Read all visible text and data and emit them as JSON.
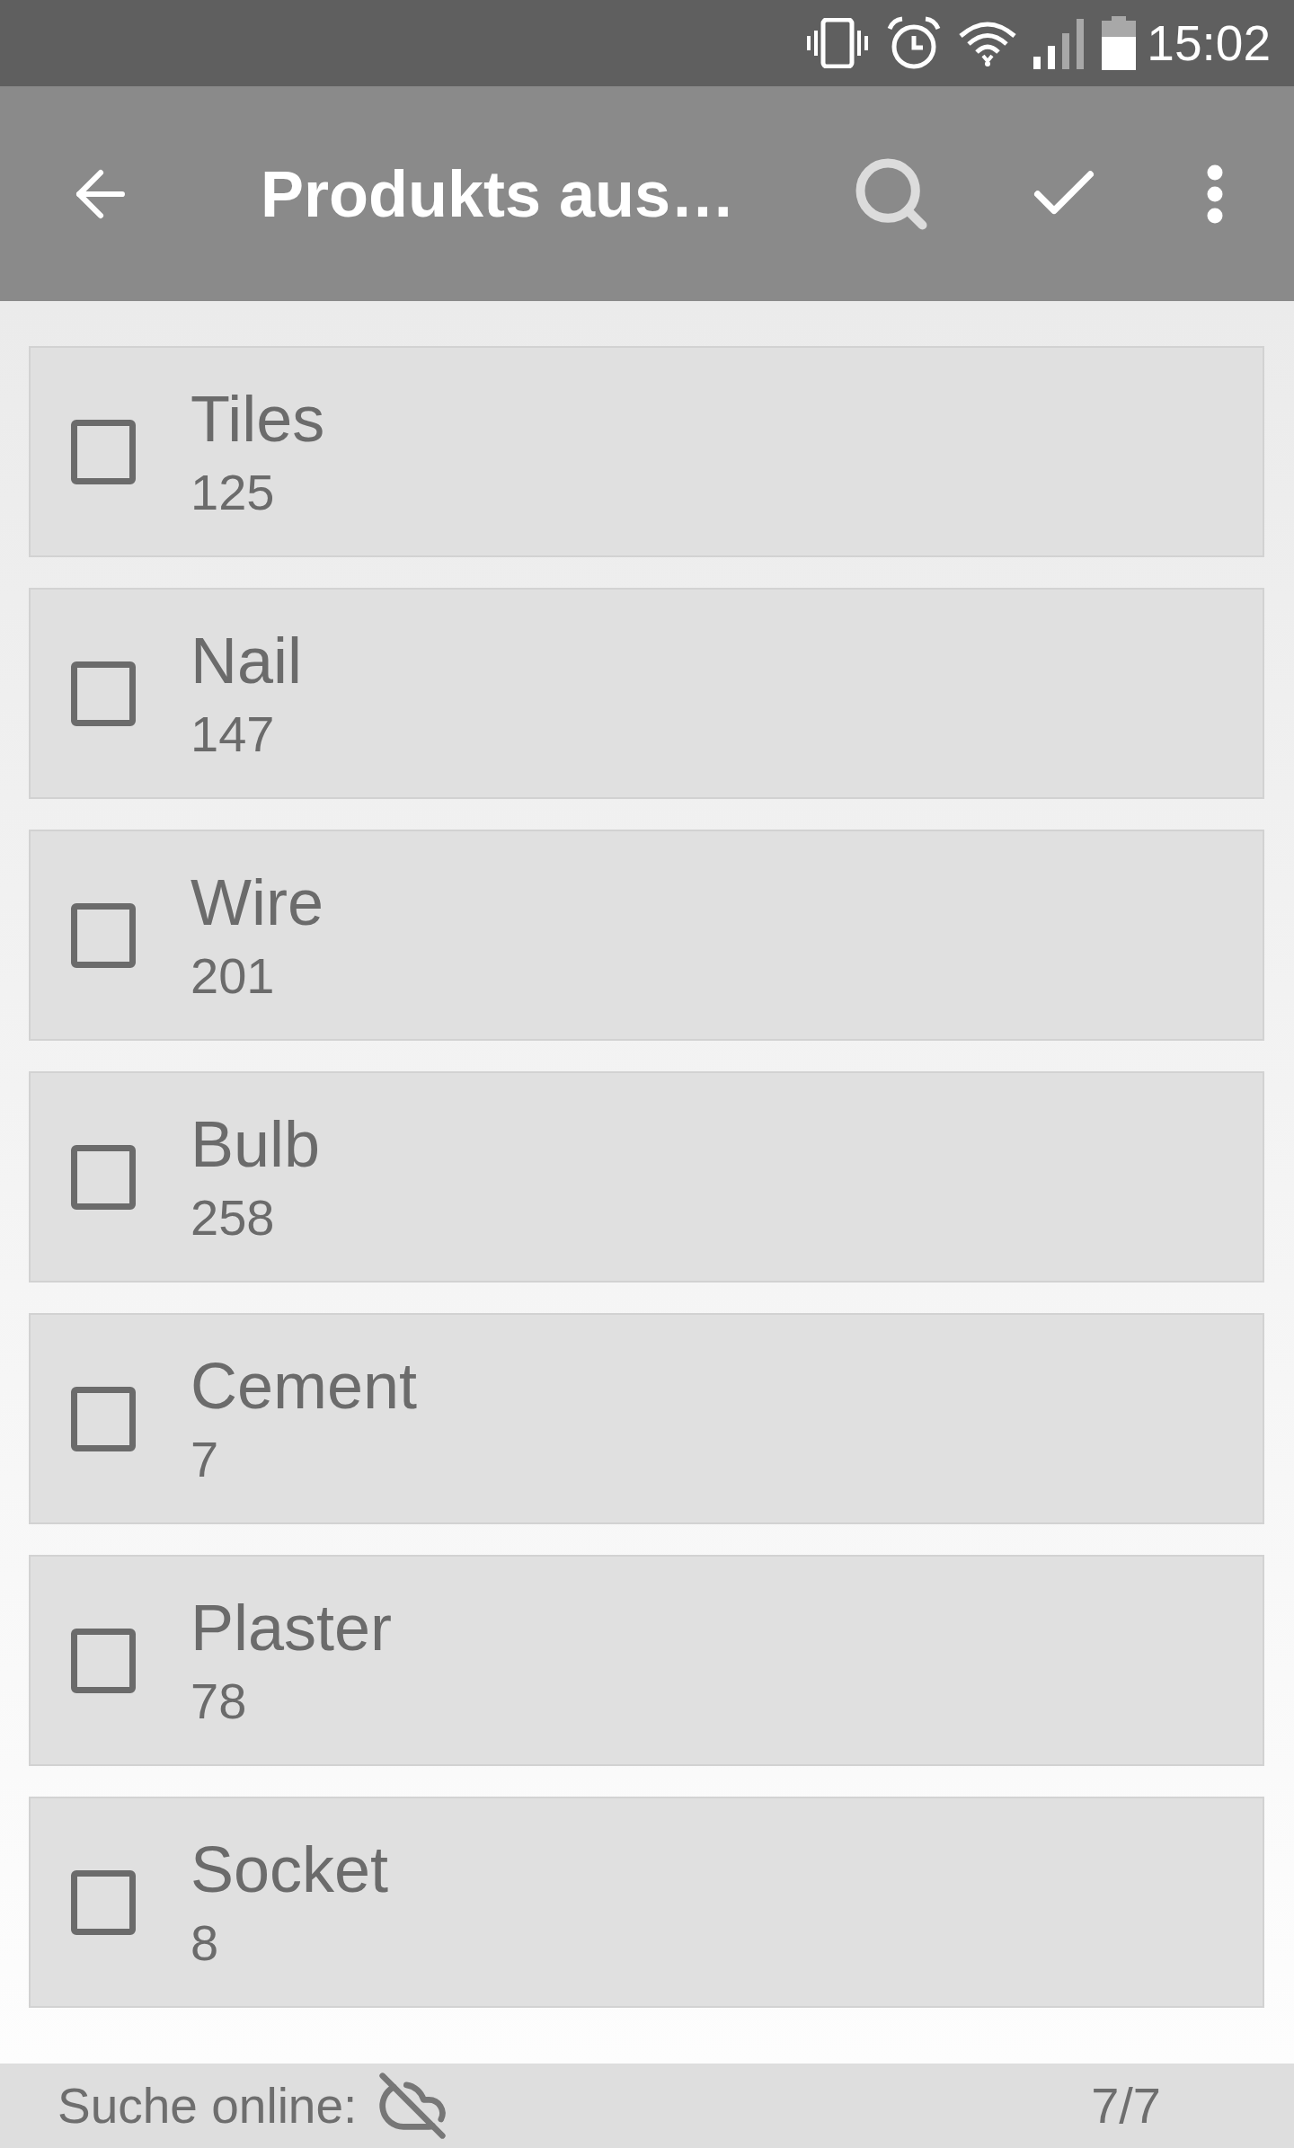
{
  "status_bar": {
    "time": "15:02"
  },
  "app_bar": {
    "title": "Produkts aus…"
  },
  "items": [
    {
      "name": "Tiles",
      "number": "125",
      "checked": false
    },
    {
      "name": "Nail",
      "number": "147",
      "checked": false
    },
    {
      "name": "Wire",
      "number": "201",
      "checked": false
    },
    {
      "name": "Bulb",
      "number": "258",
      "checked": false
    },
    {
      "name": "Cement",
      "number": "7",
      "checked": false
    },
    {
      "name": "Plaster",
      "number": "78",
      "checked": false
    },
    {
      "name": "Socket",
      "number": "8",
      "checked": false
    }
  ],
  "footer": {
    "label": "Suche online:",
    "online": false,
    "count": "7/7"
  }
}
